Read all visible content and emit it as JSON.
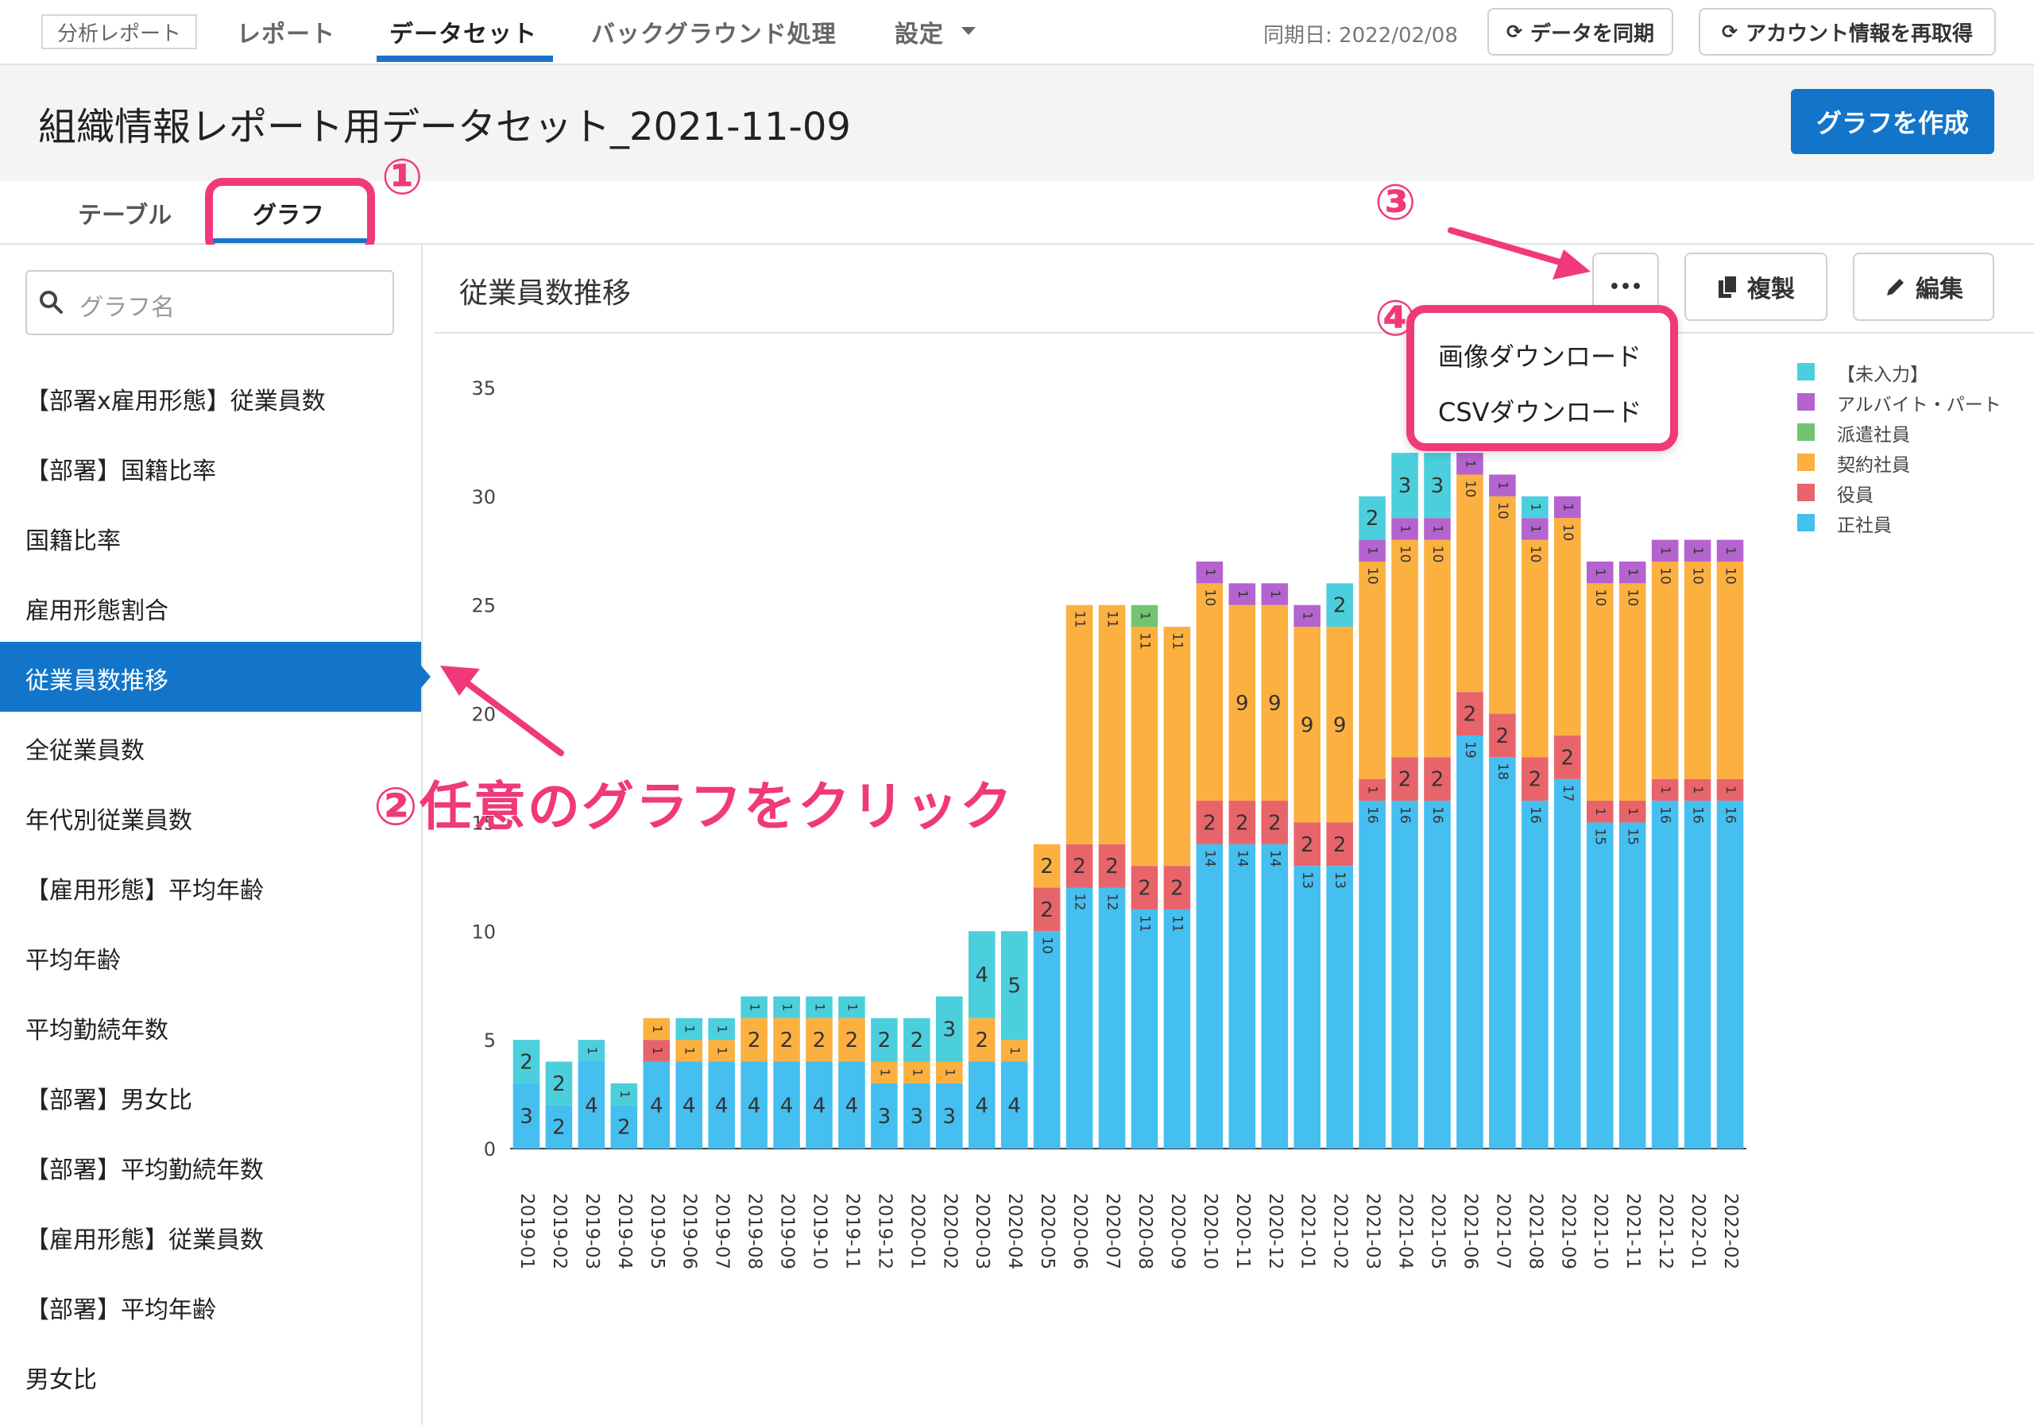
{
  "nav": {
    "logo": "分析レポート",
    "tabs": [
      "レポート",
      "データセット",
      "バックグラウンド処理",
      "設定"
    ],
    "active_tab": "データセット",
    "sync_date": "同期日: 2022/02/08",
    "sync_button": "データを同期",
    "reacquire_button": "アカウント情報を再取得"
  },
  "header": {
    "title": "組織情報レポート用データセット_2021-11-09",
    "create_button": "グラフを作成"
  },
  "subtabs": [
    "テーブル",
    "グラフ"
  ],
  "sidebar": {
    "search_placeholder": "グラフ名",
    "items": [
      "【部署x雇用形態】従業員数",
      "【部署】国籍比率",
      "国籍比率",
      "雇用形態割合",
      "従業員数推移",
      "全従業員数",
      "年代別従業員数",
      "【雇用形態】平均年齢",
      "平均年齢",
      "平均勤続年数",
      "【部署】男女比",
      "【部署】平均勤続年数",
      "【雇用形態】従業員数",
      "【部署】平均年齢",
      "男女比"
    ],
    "selected": "従業員数推移"
  },
  "panel": {
    "chart_title": "従業員数推移",
    "more_label": "•••",
    "duplicate_button": "複製",
    "edit_button": "編集",
    "menu": [
      "画像ダウンロード",
      "CSVダウンロード"
    ]
  },
  "annotations": {
    "n1": "①",
    "n2": "②任意のグラフをクリック",
    "n3": "③",
    "n4": "④"
  },
  "colors": {
    "accent": "#1375c9",
    "annotation": "#f0397a"
  },
  "chart_data": {
    "type": "bar",
    "stacked": true,
    "categories": [
      "2019-01",
      "2019-02",
      "2019-03",
      "2019-04",
      "2019-05",
      "2019-06",
      "2019-07",
      "2019-08",
      "2019-09",
      "2019-10",
      "2019-11",
      "2019-12",
      "2020-01",
      "2020-02",
      "2020-03",
      "2020-04",
      "2020-05",
      "2020-06",
      "2020-07",
      "2020-08",
      "2020-09",
      "2020-10",
      "2020-11",
      "2020-12",
      "2021-01",
      "2021-02",
      "2021-03",
      "2021-04",
      "2021-05",
      "2021-06",
      "2021-07",
      "2021-08",
      "2021-09",
      "2021-10",
      "2021-11",
      "2021-12",
      "2022-01",
      "2022-02"
    ],
    "ylim": [
      0,
      35
    ],
    "yticks": [
      0,
      5,
      10,
      15,
      20,
      25,
      30,
      35
    ],
    "series": [
      {
        "name": "正社員",
        "color": "#45bef0",
        "values": [
          3,
          2,
          4,
          2,
          4,
          4,
          4,
          4,
          4,
          4,
          4,
          3,
          3,
          3,
          4,
          4,
          10,
          12,
          12,
          11,
          11,
          14,
          14,
          14,
          13,
          13,
          16,
          16,
          16,
          19,
          18,
          16,
          17,
          15,
          15,
          16,
          16,
          16
        ]
      },
      {
        "name": "役員",
        "color": "#e8646b",
        "values": [
          0,
          0,
          0,
          0,
          1,
          0,
          0,
          0,
          0,
          0,
          0,
          0,
          0,
          0,
          0,
          0,
          2,
          2,
          2,
          2,
          2,
          2,
          2,
          2,
          2,
          2,
          1,
          2,
          2,
          2,
          2,
          2,
          2,
          1,
          1,
          1,
          1,
          1
        ]
      },
      {
        "name": "契約社員",
        "color": "#fbb040",
        "values": [
          0,
          0,
          0,
          0,
          1,
          1,
          1,
          2,
          2,
          2,
          2,
          1,
          1,
          1,
          2,
          1,
          2,
          11,
          11,
          11,
          11,
          10,
          9,
          9,
          9,
          9,
          10,
          10,
          10,
          10,
          10,
          10,
          10,
          10,
          10,
          10,
          10,
          10
        ]
      },
      {
        "name": "派遣社員",
        "color": "#72c472",
        "values": [
          0,
          0,
          0,
          0,
          0,
          0,
          0,
          0,
          0,
          0,
          0,
          0,
          0,
          0,
          0,
          0,
          0,
          0,
          0,
          1,
          0,
          0,
          0,
          0,
          0,
          0,
          0,
          0,
          0,
          0,
          0,
          0,
          0,
          0,
          0,
          0,
          0,
          0
        ]
      },
      {
        "name": "アルバイト・パート",
        "color": "#b463cf",
        "values": [
          0,
          0,
          0,
          0,
          0,
          0,
          0,
          0,
          0,
          0,
          0,
          0,
          0,
          0,
          0,
          0,
          0,
          0,
          0,
          0,
          0,
          1,
          1,
          1,
          1,
          0,
          1,
          1,
          1,
          1,
          1,
          1,
          1,
          1,
          1,
          1,
          1,
          1
        ]
      },
      {
        "name": "【未入力】",
        "color": "#4ccfdc",
        "values": [
          2,
          2,
          1,
          1,
          0,
          1,
          1,
          1,
          1,
          1,
          1,
          2,
          2,
          3,
          4,
          5,
          0,
          0,
          0,
          0,
          0,
          0,
          0,
          0,
          0,
          2,
          2,
          3,
          3,
          0,
          0,
          1,
          0,
          0,
          0,
          0,
          0,
          0
        ]
      }
    ],
    "legend": [
      "【未入力】",
      "アルバイト・パート",
      "派遣社員",
      "契約社員",
      "役員",
      "正社員"
    ],
    "legend_position": "right"
  }
}
